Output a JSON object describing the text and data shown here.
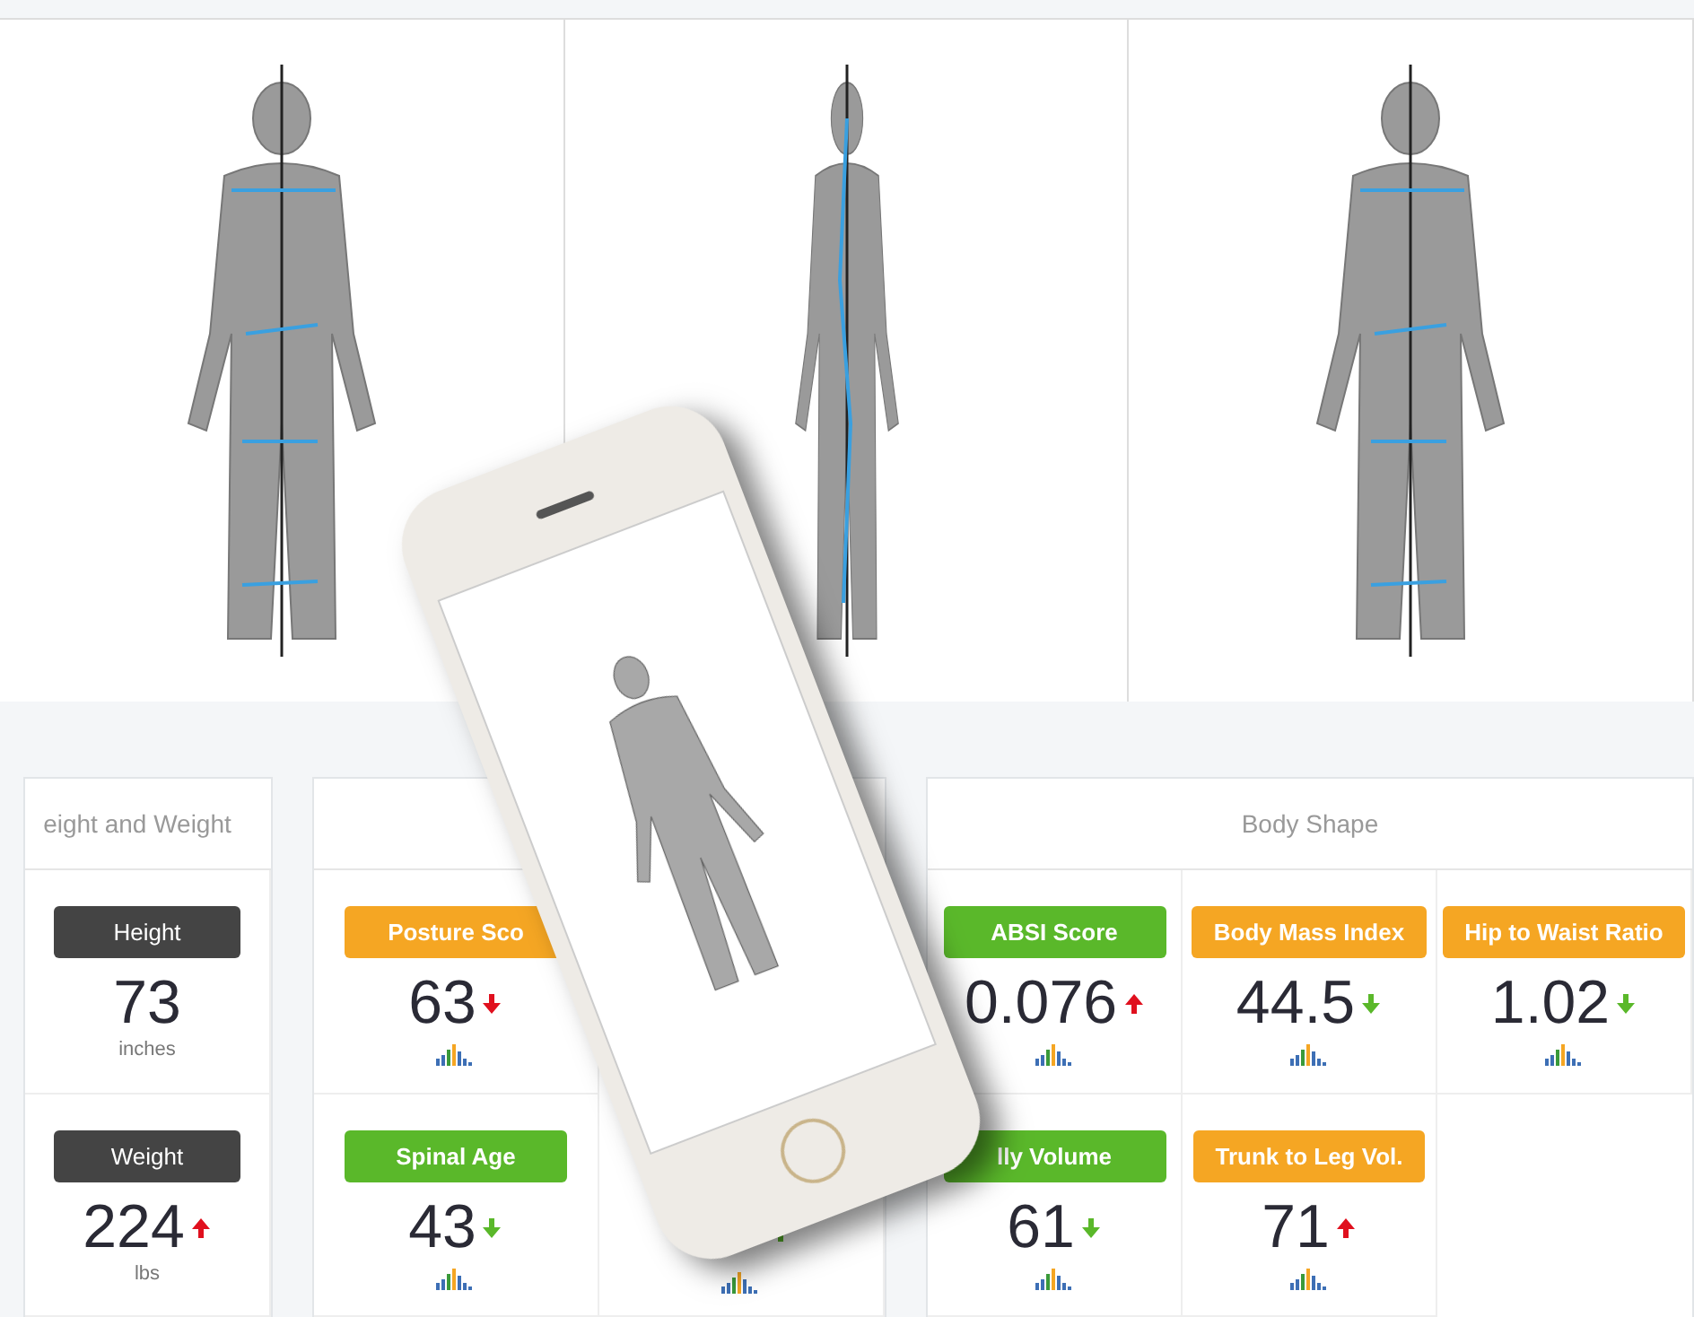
{
  "panels": [
    {
      "title": "eight and Weight",
      "kind": "stack",
      "rows": [
        [
          {
            "label": "Height",
            "color": "#444444",
            "value": "73",
            "unit": "inches"
          }
        ],
        [
          {
            "label": "Weight",
            "color": "#444444",
            "value": "224",
            "unit": "lbs",
            "rising": true,
            "favorable": false
          }
        ]
      ]
    },
    {
      "kind": "grid",
      "rows": [
        [
          {
            "label": "Posture Sco",
            "color": "#f5a623",
            "value": "63",
            "rising": false,
            "favorable": false
          }
        ],
        [
          {
            "label": "Spinal Age",
            "color": "#5ab82a",
            "value": "43",
            "rising": false,
            "favorable": true
          },
          {
            "rising": true,
            "favorable": true
          }
        ]
      ]
    },
    {
      "title": "Body Shape",
      "kind": "grid",
      "rows": [
        [
          {
            "label": "ABSI Score",
            "color": "#5ab82a",
            "value": "0.076",
            "rising": true,
            "favorable": false
          },
          {
            "label": "Body Mass Index",
            "color": "#f5a623",
            "value": "44.5",
            "rising": false,
            "favorable": true
          },
          {
            "label": "Hip to Waist Ratio",
            "color": "#f5a623",
            "value": "1.02",
            "rising": false,
            "favorable": true
          }
        ],
        [
          {
            "label": "lly Volume",
            "color": "#5ab82a",
            "value": "61",
            "rising": false,
            "favorable": true
          },
          {
            "label": "Trunk to Leg Vol.",
            "color": "#f5a623",
            "value": "71",
            "rising": true,
            "favorable": false
          }
        ]
      ]
    }
  ]
}
